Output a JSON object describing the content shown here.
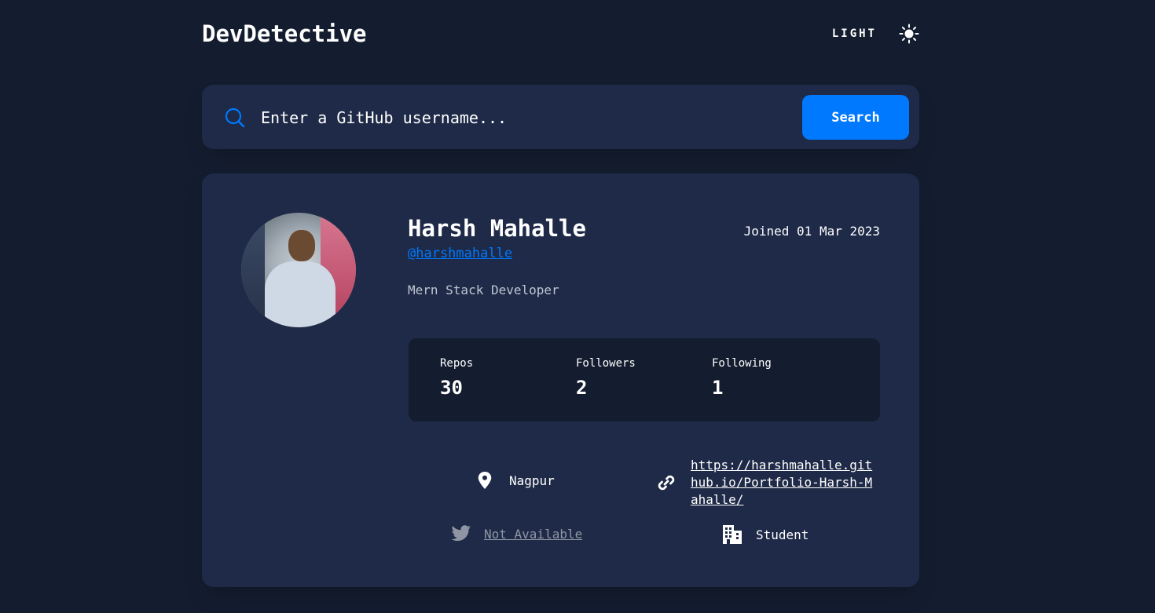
{
  "app": {
    "title": "DevDetective"
  },
  "theme_toggle": {
    "label": "LIGHT",
    "icon": "sun-icon"
  },
  "search": {
    "placeholder": "Enter a GitHub username...",
    "value": "",
    "button_label": "Search",
    "icon": "search-icon"
  },
  "profile": {
    "name": "Harsh Mahalle",
    "joined": "Joined 01 Mar 2023",
    "username": "@harshmahalle",
    "bio": "Mern Stack Developer",
    "avatar_icon": "user-avatar"
  },
  "stats": [
    {
      "label": "Repos",
      "value": "30"
    },
    {
      "label": "Followers",
      "value": "2"
    },
    {
      "label": "Following",
      "value": "1"
    }
  ],
  "links": {
    "location": {
      "icon": "location-pin-icon",
      "text": "Nagpur"
    },
    "blog": {
      "icon": "link-icon",
      "text": "https://harshmahalle.github.io/Portfolio-Harsh-Mahalle/"
    },
    "twitter": {
      "icon": "twitter-icon",
      "text": "Not Available"
    },
    "company": {
      "icon": "building-icon",
      "text": "Student"
    }
  },
  "colors": {
    "background": "#141d2f",
    "card": "#1e2a47",
    "accent": "#0079ff",
    "text": "#ffffff"
  }
}
